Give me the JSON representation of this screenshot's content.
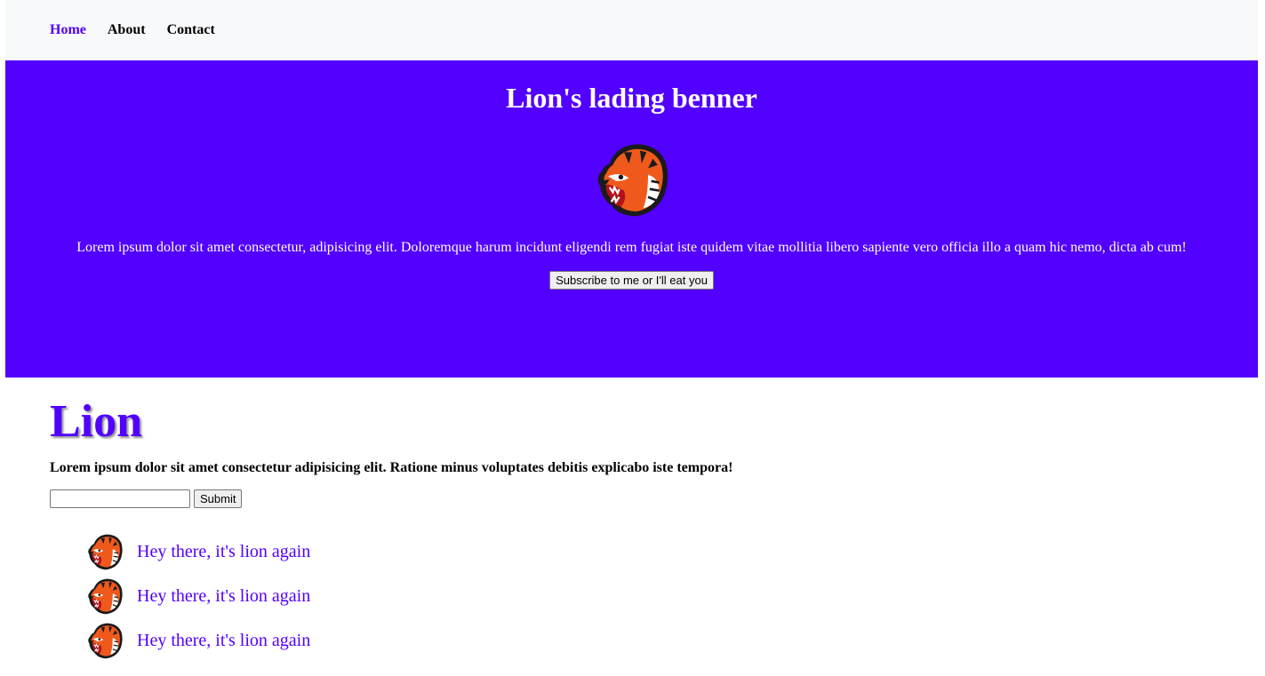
{
  "nav": {
    "items": [
      {
        "label": "Home",
        "active": true
      },
      {
        "label": "About",
        "active": false
      },
      {
        "label": "Contact",
        "active": false
      }
    ]
  },
  "banner": {
    "title": "Lion's lading benner",
    "logo_icon": "tiger-head-icon",
    "text": "Lorem ipsum dolor sit amet consectetur, adipisicing elit. Doloremque harum incidunt eligendi rem fugiat iste quidem vitae mollitia libero sapiente vero officia illo a quam hic nemo, dicta ab cum!",
    "button_label": "Subscribe to me or I'll eat you",
    "background_color": "#5200ff"
  },
  "main": {
    "heading": "Lion",
    "lead": "Lorem ipsum dolor sit amet consectetur adipisicing elit. Ratione minus voluptates debitis explicabo iste tempora!",
    "form": {
      "input_value": "",
      "submit_label": "Submit"
    },
    "list": [
      {
        "icon": "tiger-head-icon",
        "text": "Hey there, it's lion again"
      },
      {
        "icon": "tiger-head-icon",
        "text": "Hey there, it's lion again"
      },
      {
        "icon": "tiger-head-icon",
        "text": "Hey there, it's lion again"
      }
    ]
  },
  "colors": {
    "accent": "#5200ff",
    "navbar_bg": "#f8f9fa"
  }
}
